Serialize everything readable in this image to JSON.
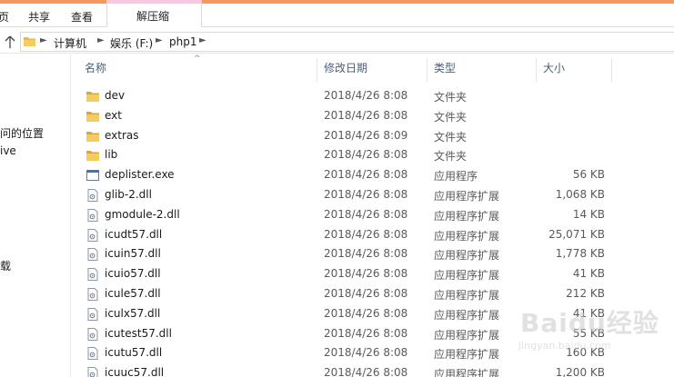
{
  "ribbon": {
    "tabs": [
      "页",
      "共享",
      "查看"
    ],
    "context_tab": "解压缩"
  },
  "address": {
    "crumbs": [
      "计算机",
      "娱乐 (F:)",
      "php1"
    ]
  },
  "nav": {
    "items": [
      "问的位置",
      "ive",
      "载"
    ]
  },
  "columns": {
    "name": "名称",
    "date": "修改日期",
    "type": "类型",
    "size": "大小"
  },
  "files": [
    {
      "name": "dev",
      "date": "2018/4/26 8:08",
      "type": "文件夹",
      "size": "",
      "icon": "folder-icon"
    },
    {
      "name": "ext",
      "date": "2018/4/26 8:08",
      "type": "文件夹",
      "size": "",
      "icon": "folder-icon"
    },
    {
      "name": "extras",
      "date": "2018/4/26 8:09",
      "type": "文件夹",
      "size": "",
      "icon": "folder-icon"
    },
    {
      "name": "lib",
      "date": "2018/4/26 8:08",
      "type": "文件夹",
      "size": "",
      "icon": "folder-icon"
    },
    {
      "name": "deplister.exe",
      "date": "2018/4/26 8:08",
      "type": "应用程序",
      "size": "56 KB",
      "icon": "exe-icon"
    },
    {
      "name": "glib-2.dll",
      "date": "2018/4/26 8:08",
      "type": "应用程序扩展",
      "size": "1,068 KB",
      "icon": "dll-icon"
    },
    {
      "name": "gmodule-2.dll",
      "date": "2018/4/26 8:08",
      "type": "应用程序扩展",
      "size": "14 KB",
      "icon": "dll-icon"
    },
    {
      "name": "icudt57.dll",
      "date": "2018/4/26 8:08",
      "type": "应用程序扩展",
      "size": "25,071 KB",
      "icon": "dll-icon"
    },
    {
      "name": "icuin57.dll",
      "date": "2018/4/26 8:08",
      "type": "应用程序扩展",
      "size": "1,778 KB",
      "icon": "dll-icon"
    },
    {
      "name": "icuio57.dll",
      "date": "2018/4/26 8:08",
      "type": "应用程序扩展",
      "size": "41 KB",
      "icon": "dll-icon"
    },
    {
      "name": "icule57.dll",
      "date": "2018/4/26 8:08",
      "type": "应用程序扩展",
      "size": "212 KB",
      "icon": "dll-icon"
    },
    {
      "name": "iculx57.dll",
      "date": "2018/4/26 8:08",
      "type": "应用程序扩展",
      "size": "41 KB",
      "icon": "dll-icon"
    },
    {
      "name": "icutest57.dll",
      "date": "2018/4/26 8:08",
      "type": "应用程序扩展",
      "size": "55 KB",
      "icon": "dll-icon"
    },
    {
      "name": "icutu57.dll",
      "date": "2018/4/26 8:08",
      "type": "应用程序扩展",
      "size": "160 KB",
      "icon": "dll-icon"
    },
    {
      "name": "icuuc57.dll",
      "date": "2018/4/26 8:08",
      "type": "应用程序扩展",
      "size": "1,200 KB",
      "icon": "dll-icon"
    }
  ],
  "watermark": {
    "brand": "Baidu经验",
    "url": "jingyan.baidu.com"
  },
  "colors": {
    "accent": "#f09860",
    "context_tab": "#f7c7e0",
    "folder": "#e8b84a",
    "header_text": "#4c607a"
  }
}
